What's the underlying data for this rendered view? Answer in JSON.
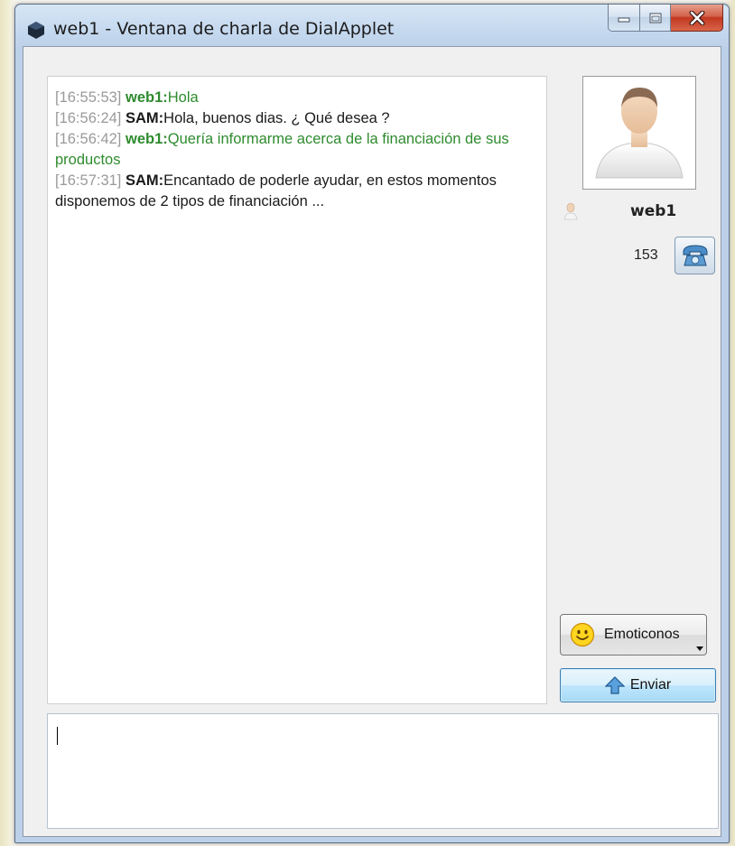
{
  "window": {
    "title": "web1 - Ventana de charla de DialApplet",
    "controls": [
      "minimize",
      "maximize",
      "close"
    ],
    "icon": "app-cube-icon"
  },
  "chat": {
    "messages": [
      {
        "time": "[16:55:53]",
        "sender": "web1:",
        "text": "Hola",
        "color": "#2e8b2e"
      },
      {
        "time": "[16:56:24]",
        "sender": "SAM:",
        "text": "Hola, buenos dias. ¿ Qué desea ?",
        "color": "#1a1a1a"
      },
      {
        "time": "[16:56:42]",
        "sender": "web1:",
        "text": "Quería informarme acerca de la financiación de sus productos",
        "color": "#2e8b2e"
      },
      {
        "time": "[16:57:31]",
        "sender": "SAM:",
        "text": "Encantado de poderle ayudar, en estos momentos disponemos de 2 tipos de financiación ...",
        "color": "#1a1a1a"
      }
    ]
  },
  "contact": {
    "name": "web1",
    "extension": "153",
    "avatar_icon": "user-avatar-icon",
    "phone_icon": "telephone-icon"
  },
  "buttons": {
    "emoticons_label": "Emoticonos",
    "send_label": "Enviar"
  },
  "input": {
    "value": ""
  },
  "colors": {
    "green_user": "#2e8b2e",
    "timestamp": "#9a9a9a",
    "send_button": "#a7d9f5"
  }
}
